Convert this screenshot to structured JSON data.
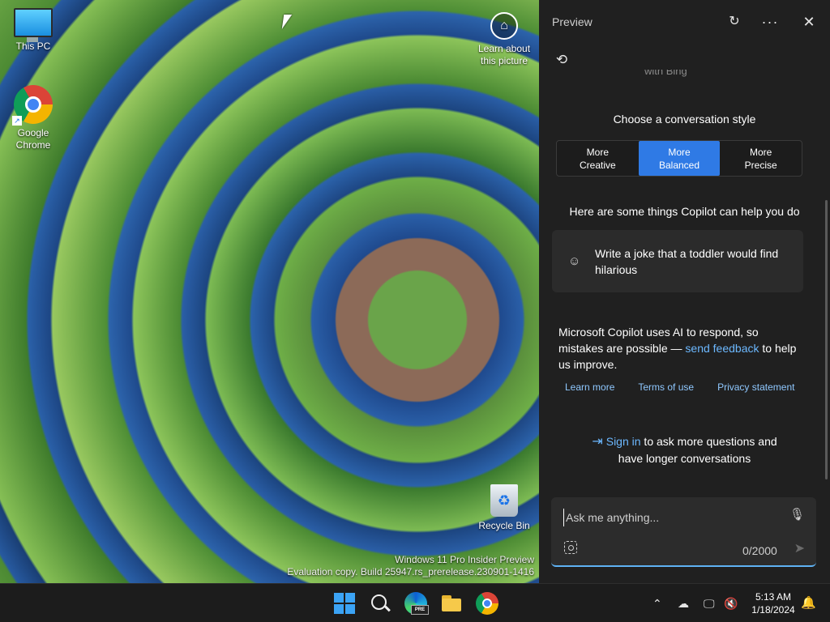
{
  "desktop": {
    "icons": [
      {
        "label": "This PC"
      },
      {
        "label": "Google Chrome"
      },
      {
        "label": "Learn about this picture"
      },
      {
        "label": "Recycle Bin"
      }
    ],
    "watermark": {
      "line1": "Windows 11 Pro Insider Preview",
      "line2": "Evaluation copy. Build 25947.rs_prerelease.230901-1416"
    }
  },
  "panel": {
    "title": "Preview",
    "with_bing": "with Bing",
    "style_heading": "Choose a conversation style",
    "styles": [
      {
        "line1": "More",
        "line2": "Creative",
        "selected": false
      },
      {
        "line1": "More",
        "line2": "Balanced",
        "selected": true
      },
      {
        "line1": "More",
        "line2": "Precise",
        "selected": false
      }
    ],
    "help_heading": "Here are some things Copilot can help you do",
    "suggestion": "Write a joke that a toddler would find hilarious",
    "disclaimer": {
      "before": "Microsoft Copilot uses AI to respond, so mistakes are possible — ",
      "link": "send feedback",
      "after": " to help us improve."
    },
    "links": [
      "Learn more",
      "Terms of use",
      "Privacy statement"
    ],
    "signin": {
      "link": "Sign in",
      "text1": " to ask more questions and",
      "text2": "have longer conversations"
    },
    "chat": {
      "placeholder": "Ask me anything...",
      "char_count": "0/2000"
    }
  },
  "taskbar": {
    "apps": [
      "Start",
      "Search",
      "Microsoft Edge Preview",
      "File Explorer",
      "Google Chrome"
    ],
    "edge_badge": "PRE",
    "clock": {
      "time": "5:13 AM",
      "date": "1/18/2024"
    }
  },
  "colors": {
    "accent": "#2f7ae5",
    "link": "#6cb8ff",
    "panel_bg": "#202020",
    "taskbar_bg": "#1c1c1c"
  }
}
